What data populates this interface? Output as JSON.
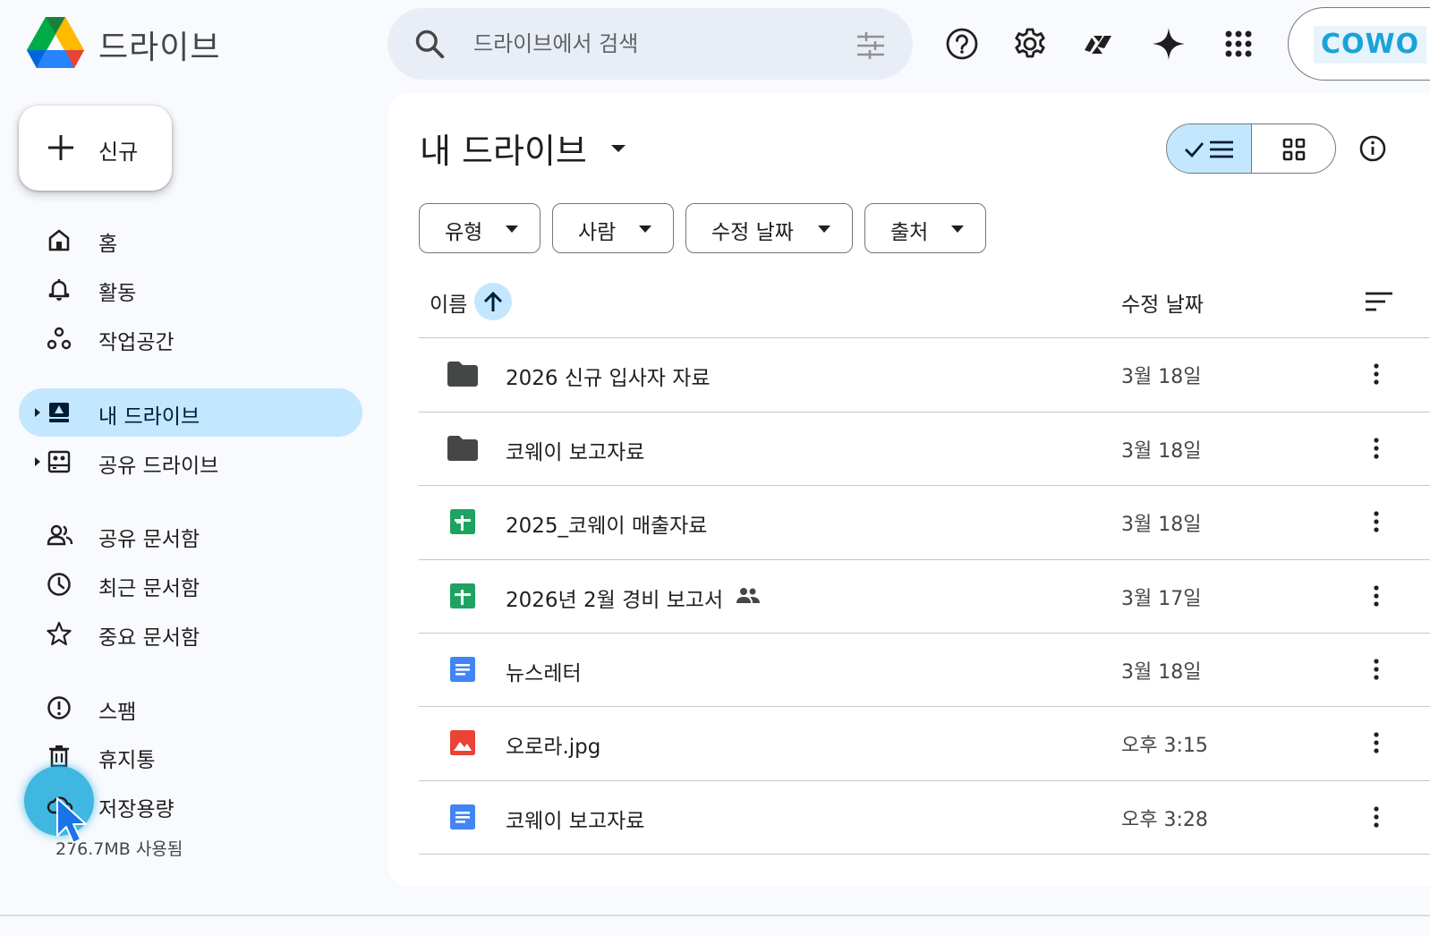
{
  "app": {
    "title": "드라이브"
  },
  "search": {
    "placeholder": "드라이브에서 검색"
  },
  "header_icons": [
    "help-icon",
    "settings-icon",
    "gemini-addon-icon",
    "gemini-spark-icon",
    "apps-grid-icon"
  ],
  "account": {
    "label": "COWO"
  },
  "sidebar": {
    "new_label": "신규",
    "items": [
      {
        "label": "홈",
        "icon": "home-icon"
      },
      {
        "label": "활동",
        "icon": "bell-icon"
      },
      {
        "label": "작업공간",
        "icon": "workspaces-icon"
      },
      {
        "label": "내 드라이브",
        "icon": "my-drive-icon",
        "active": true
      },
      {
        "label": "공유 드라이브",
        "icon": "shared-drives-icon"
      },
      {
        "label": "공유 문서함",
        "icon": "people-icon"
      },
      {
        "label": "최근 문서함",
        "icon": "clock-icon"
      },
      {
        "label": "중요 문서함",
        "icon": "star-icon"
      },
      {
        "label": "스팸",
        "icon": "spam-icon"
      },
      {
        "label": "휴지통",
        "icon": "trash-icon"
      },
      {
        "label": "저장용량",
        "icon": "cloud-icon"
      }
    ],
    "storage_used": "276.7MB 사용됨"
  },
  "main": {
    "title": "내 드라이브",
    "filters": [
      "유형",
      "사람",
      "수정 날짜",
      "출처"
    ],
    "columns": {
      "name": "이름",
      "modified": "수정 날짜"
    },
    "files": [
      {
        "name": "2026 신규 입사자 자료",
        "type": "folder",
        "modified": "3월 18일",
        "shared": false
      },
      {
        "name": "코웨이 보고자료",
        "type": "folder",
        "modified": "3월 18일",
        "shared": false
      },
      {
        "name": "2025_코웨이 매출자료",
        "type": "sheets",
        "modified": "3월 18일",
        "shared": false
      },
      {
        "name": "2026년 2월 경비 보고서",
        "type": "sheets",
        "modified": "3월 17일",
        "shared": true
      },
      {
        "name": "뉴스레터",
        "type": "docs",
        "modified": "3월 18일",
        "shared": false
      },
      {
        "name": "오로라.jpg",
        "type": "image",
        "modified": "오후 3:15",
        "shared": false
      },
      {
        "name": "코웨이 보고자료",
        "type": "docs",
        "modified": "오후 3:28",
        "shared": false
      }
    ]
  },
  "colors": {
    "accent_bg": "#c2e7ff",
    "sheets_green": "#1ea362",
    "docs_blue": "#4285f4",
    "image_red": "#ea4335",
    "folder_gray": "#444746"
  }
}
